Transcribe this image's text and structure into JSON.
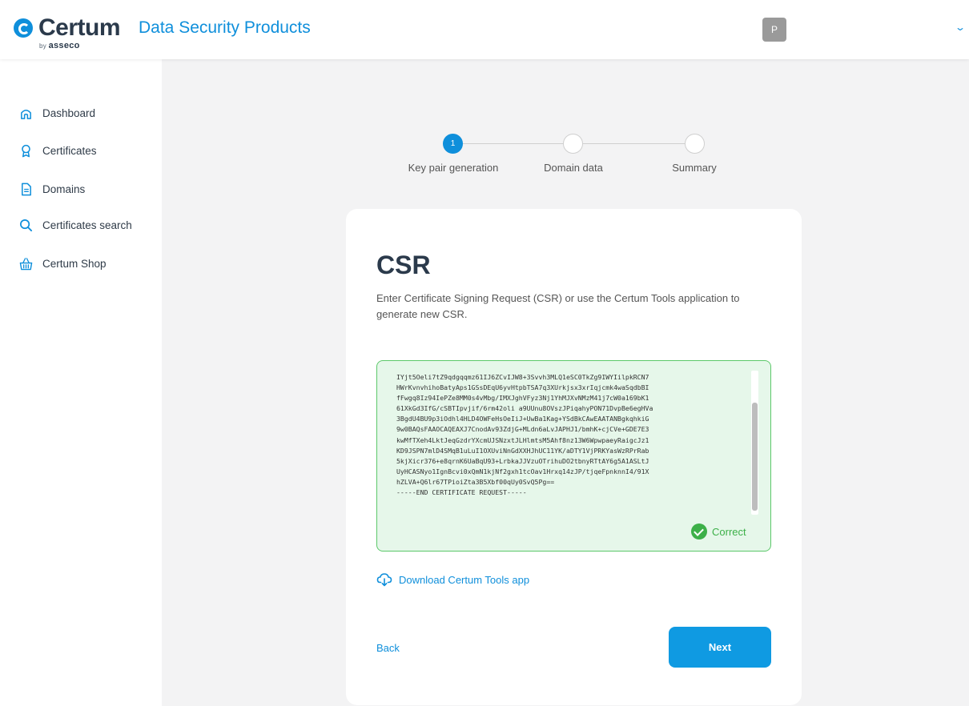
{
  "header": {
    "logo_text": "Certum",
    "logo_by": "by",
    "logo_company": "asseco",
    "product_name": "Data Security Products",
    "user_initial": "P",
    "chevron": "⌄"
  },
  "sidebar": {
    "items": [
      {
        "label": "Dashboard",
        "icon": "home-icon"
      },
      {
        "label": "Certificates",
        "icon": "certificate-icon"
      },
      {
        "label": "Domains",
        "icon": "document-icon"
      },
      {
        "label": "Certificates search",
        "icon": "search-icon"
      },
      {
        "label": "Certum Shop",
        "icon": "basket-icon"
      }
    ]
  },
  "stepper": {
    "steps": [
      {
        "number": "1",
        "label": "Key pair generation",
        "active": true
      },
      {
        "number": "",
        "label": "Domain data",
        "active": false
      },
      {
        "number": "",
        "label": "Summary",
        "active": false
      }
    ]
  },
  "card": {
    "title": "CSR",
    "description": "Enter Certificate Signing Request (CSR) or use the Certum Tools application to generate new CSR.",
    "csr_value": "IYjt5Oeli7tZ9qdgqqmz61IJ6ZCvIJW8+3Svvh3MLQ1eSC0TkZg9IWYIilpkRCN7\nHWrKvnvhihoBatyAps1GSsDEqU6yvHtpbTSA7q3XUrkjsx3xrIqjcmk4waSqdbBI\nfFwgq8Iz94IePZe8MM0s4vMbg/IMXJghVFyz3Nj1YhMJXvNMzM41j7cW0a169bK1\n61XkGd3IfG/cSBTIpvjif/6rm42oli a9UUnu8OVszJPiqahyPON71DvpBe6egHVa\n3BgdU4BU9p3iOdhl4HLD4OWFeHsOeIiJ+UwBa1Kag+YSdBkCAwEAATANBgkqhkiG\n9w0BAQsFAAOCAQEAXJ7CnodAv93ZdjG+MLdn6aLvJAPHJ1/bmhK+cjCVe+GDE7E3\nkwMfTXeh4LktJeqGzdrYXcmUJSNzxtJLHlmtsM5Ahf8nz13W6WpwpaeyRaigcJz1\nKD9JSPN7mlD4SMqB1uLuI1OXUviNnGdXXHJhUC11YK/aDTY1VjPRKYasWzRPrRab\n5kjXicr376+e8qrnK6UaBqU93+LrbkaJJVzuOTrihuDO2tbnyRTtAY6g5A1ASLtJ\nUyHCASNyo1IgnBcvi0xQmN1kjNf2gxh1tcOav1Hrxq14zJP/tjqeFpnknnI4/91X\nhZLVA+Q6lr67TPioiZta3B5Xbf00qUy0SvQ5Pg==\n-----END CERTIFICATE REQUEST-----",
    "status_label": "Correct",
    "download_label": "Download Certum Tools app",
    "back_label": "Back",
    "next_label": "Next"
  },
  "colors": {
    "accent": "#0f8fdb",
    "success": "#3cb048",
    "success_bg": "#e6f7ea"
  }
}
